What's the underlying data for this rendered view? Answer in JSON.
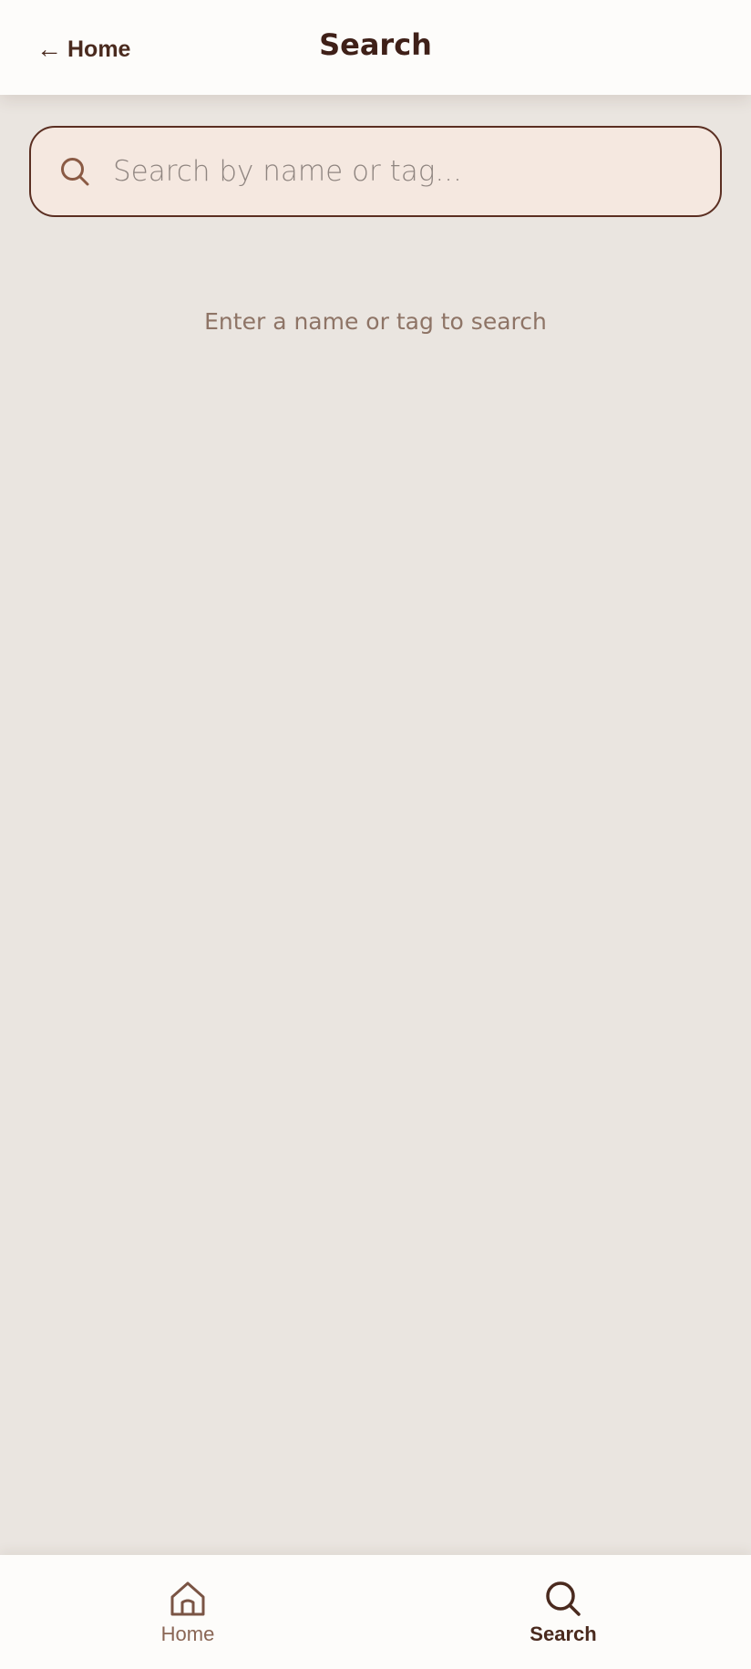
{
  "header": {
    "back_label": "Home",
    "back_arrow": "←",
    "title": "Search"
  },
  "search": {
    "placeholder": "Search by name or tag...",
    "value": "",
    "icon": "search-icon"
  },
  "empty_state": {
    "message": "Enter a name or tag to search"
  },
  "bottom_nav": {
    "items": [
      {
        "label": "Home",
        "icon": "home-icon",
        "active": false
      },
      {
        "label": "Search",
        "icon": "search-icon",
        "active": true
      }
    ]
  },
  "colors": {
    "background": "#eae5e0",
    "surface": "#fdfcfa",
    "accent_dark": "#4a2a1e",
    "input_fill": "#f5e8e0",
    "muted": "#8e7466"
  }
}
